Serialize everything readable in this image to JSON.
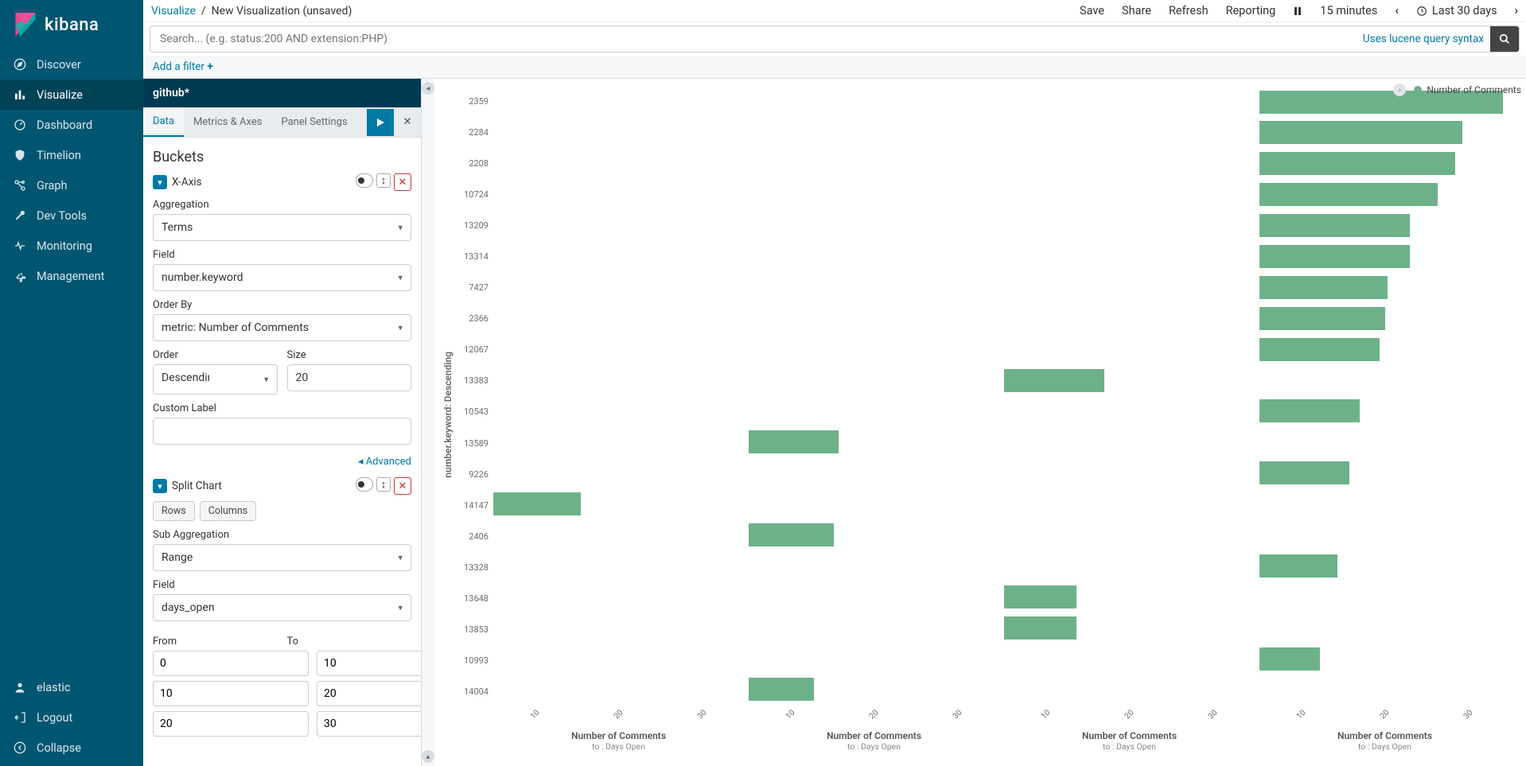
{
  "app": {
    "name": "kibana"
  },
  "nav": {
    "items": [
      {
        "id": "discover",
        "label": "Discover"
      },
      {
        "id": "visualize",
        "label": "Visualize"
      },
      {
        "id": "dashboard",
        "label": "Dashboard"
      },
      {
        "id": "timelion",
        "label": "Timelion"
      },
      {
        "id": "graph",
        "label": "Graph"
      },
      {
        "id": "devtools",
        "label": "Dev Tools"
      },
      {
        "id": "monitoring",
        "label": "Monitoring"
      },
      {
        "id": "management",
        "label": "Management"
      }
    ],
    "bottom": [
      {
        "id": "user",
        "label": "elastic"
      },
      {
        "id": "logout",
        "label": "Logout"
      },
      {
        "id": "collapse",
        "label": "Collapse"
      }
    ]
  },
  "breadcrumb": {
    "root": "Visualize",
    "current": "New Visualization (unsaved)"
  },
  "topbar": {
    "save": "Save",
    "share": "Share",
    "refresh": "Refresh",
    "reporting": "Reporting",
    "interval": "15 minutes",
    "range": "Last 30 days"
  },
  "search": {
    "placeholder": "Search... (e.g. status:200 AND extension:PHP)",
    "lucene": "Uses lucene query syntax"
  },
  "filter": {
    "add": "Add a filter"
  },
  "panel": {
    "index": "github*",
    "tabs": {
      "data": "Data",
      "metrics": "Metrics & Axes",
      "settings": "Panel Settings"
    },
    "section": "Buckets",
    "xaxis": {
      "title": "X-Axis",
      "agg_label": "Aggregation",
      "agg_value": "Terms",
      "field_label": "Field",
      "field_value": "number.keyword",
      "orderby_label": "Order By",
      "orderby_value": "metric: Number of Comments",
      "order_label": "Order",
      "order_value": "Descending",
      "size_label": "Size",
      "size_value": "20",
      "custom_label": "Custom Label",
      "advanced": "Advanced"
    },
    "split": {
      "title": "Split Chart",
      "rows": "Rows",
      "columns": "Columns",
      "subagg_label": "Sub Aggregation",
      "subagg_value": "Range",
      "field_label": "Field",
      "field_value": "days_open",
      "from_label": "From",
      "to_label": "To",
      "ranges": [
        {
          "from": "0",
          "to": "10"
        },
        {
          "from": "10",
          "to": "20"
        },
        {
          "from": "20",
          "to": "30"
        }
      ]
    }
  },
  "chart_data": {
    "type": "bar",
    "y_label": "number.keyword: Descending",
    "legend": "Number of Comments",
    "categories": [
      "2359",
      "2284",
      "2208",
      "10724",
      "13209",
      "13314",
      "7427",
      "2366",
      "12067",
      "13383",
      "10543",
      "13589",
      "9226",
      "14147",
      "2406",
      "13328",
      "13648",
      "13853",
      "10993",
      "14004"
    ],
    "x_ticks": [
      "10",
      "20",
      "30"
    ],
    "panels": [
      {
        "title": "Number of Comments",
        "sub": "to : Days Open",
        "bars": {
          "14147": 35
        }
      },
      {
        "title": "Number of Comments",
        "sub": "to : Days Open",
        "bars": {
          "13589": 36,
          "2406": 34,
          "14004": 26
        }
      },
      {
        "title": "Number of Comments",
        "sub": "to : Days Open",
        "bars": {
          "13383": 40,
          "13648": 29,
          "13853": 29
        }
      },
      {
        "title": "Number of Comments",
        "sub": "to : Days Open",
        "bars": {
          "2359": 97,
          "2284": 81,
          "2208": 78,
          "10724": 71,
          "13209": 60,
          "13314": 60,
          "7427": 51,
          "2366": 50,
          "12067": 48,
          "10543": 40,
          "9226": 36,
          "13328": 31,
          "10993": 24
        }
      }
    ]
  }
}
